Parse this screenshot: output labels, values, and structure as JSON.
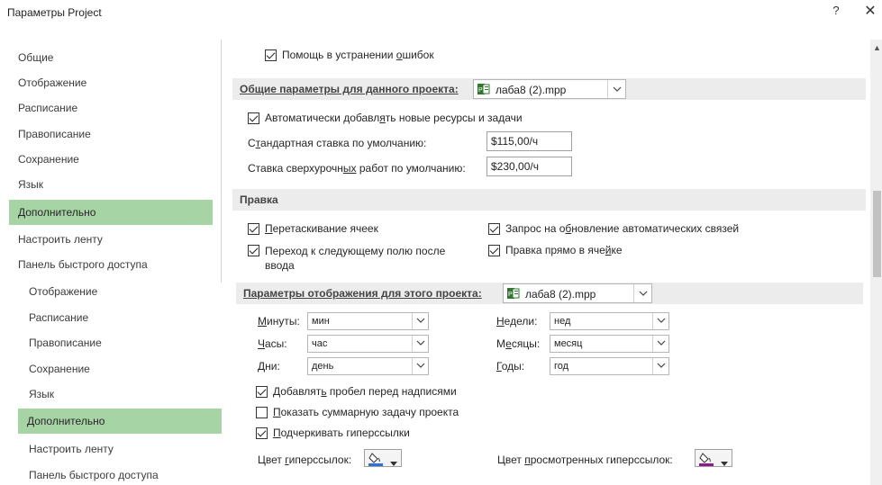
{
  "window": {
    "title": "Параметры Project",
    "help_label": "?",
    "close_label": "✕"
  },
  "nav_top": {
    "items": [
      "Общие",
      "Отображение",
      "Расписание",
      "Правописание",
      "Сохранение",
      "Язык",
      "Дополнительно",
      "Настроить ленту",
      "Панель быстрого доступа"
    ],
    "selected": "Дополнительно"
  },
  "nav_bottom": {
    "items": [
      "Отображение",
      "Расписание",
      "Правописание",
      "Сохранение",
      "Язык",
      "Дополнительно",
      "Настроить ленту",
      "Панель быстрого доступа"
    ],
    "selected": "Дополнительно"
  },
  "top": {
    "error_help_label_pre": "Помощь в устранении ",
    "error_help_label_u": "о",
    "error_help_label_post": "шибок",
    "error_help_checked": true
  },
  "general": {
    "header": "Общие параметры для данного проекта:",
    "project_file": "лаба8 (2).mpp",
    "auto_add_label_pre": "Автоматически добавл",
    "auto_add_label_u": "я",
    "auto_add_label_post": "ть новые ресурсы и задачи",
    "auto_add_checked": true,
    "std_rate_label_pre": "С",
    "std_rate_label_u": "т",
    "std_rate_label_post": "андартная ставка по умолчанию:",
    "std_rate_value": "$115,00/ч",
    "ot_rate_label_pre": "Ставка сверхурочн",
    "ot_rate_label_u": "ых",
    "ot_rate_label_post": " работ по умолчанию:",
    "ot_rate_value": "$230,00/ч"
  },
  "edit": {
    "header": "Правка",
    "drag_cells_label_u": "П",
    "drag_cells_label_post": "еретаскивание ячеек",
    "drag_cells_checked": true,
    "update_links_label_pre": "Запрос на о",
    "update_links_label_u": "б",
    "update_links_label_post": "новление автоматических связей",
    "update_links_checked": true,
    "move_next_label_pre": "Перехо",
    "move_next_label_u": "д",
    "move_next_label_post": " к следующему полю после",
    "move_next_label_line2": "ввода",
    "move_next_checked": true,
    "edit_in_cell_label_pre": "Правка прямо в яче",
    "edit_in_cell_label_u": "й",
    "edit_in_cell_label_post": "ке",
    "edit_in_cell_checked": true
  },
  "display": {
    "header": "Параметры отображения для этого проекта:",
    "project_file": "лаба8 (2).mpp",
    "minutes_label_u": "М",
    "minutes_label_post": "инуты:",
    "minutes_value": "мин",
    "hours_label_u": "Ч",
    "hours_label_post": "асы:",
    "hours_value": "час",
    "days_label_u": "Д",
    "days_label_post": "ни:",
    "days_value": "день",
    "weeks_label_u": "Н",
    "weeks_label_post": "едели:",
    "weeks_value": "нед",
    "months_label_pre": "М",
    "months_label_u": "е",
    "months_label_post": "сяцы:",
    "months_value": "месяц",
    "years_label_u": "Г",
    "years_label_post": "оды:",
    "years_value": "год",
    "add_space_label_pre": "Добавлят",
    "add_space_label_u": "ь",
    "add_space_label_post": " пробел перед надписями",
    "add_space_checked": true,
    "summary_label_u": "П",
    "summary_label_post": "оказать суммарную задачу проекта",
    "summary_checked": false,
    "underline_label_u": "П",
    "underline_label_post": "одчеркивать гиперссылки",
    "underline_checked": true,
    "link_color_label_pre": "Цвет ",
    "link_color_label_u": "г",
    "link_color_label_post": "иперссылок:",
    "link_color": "#2f6fd6",
    "visited_color_label_pre": "Цвет ",
    "visited_color_label_u": "п",
    "visited_color_label_post": "росмотренных гиперссылок:",
    "visited_color": "#8b1a8b"
  },
  "icons": [
    "help-icon",
    "close-icon",
    "checkbox-icon",
    "project-file-icon",
    "chevron-down-icon",
    "paint-bucket-icon",
    "scroll-up-arrow-icon"
  ],
  "colors": {
    "nav_selected": "#a7d4a4",
    "section_header_bg": "#ececec"
  }
}
